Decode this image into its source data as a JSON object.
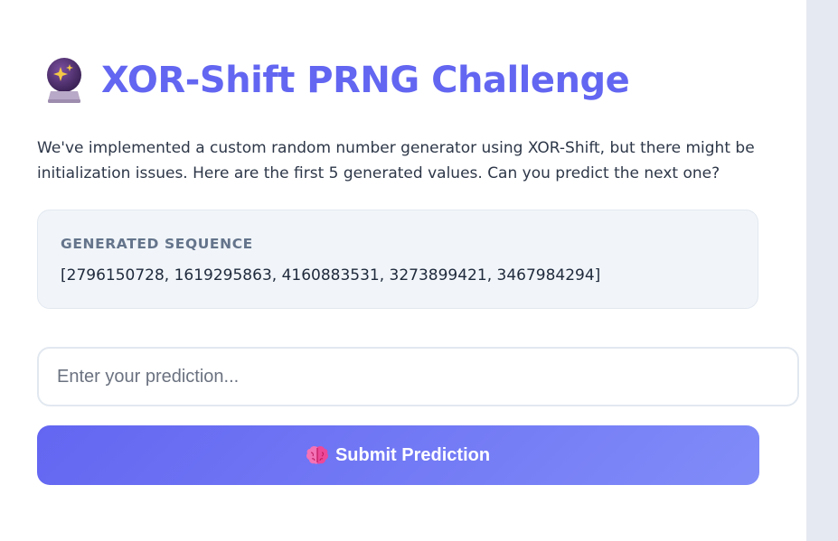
{
  "header": {
    "icon": "crystal-ball-icon",
    "title": "XOR-Shift PRNG Challenge"
  },
  "description": "We've implemented a custom random number generator using XOR-Shift, but there might be initialization issues. Here are the first 5 generated values. Can you predict the next one?",
  "sequence": {
    "label": "GENERATED SEQUENCE",
    "values_text": "[2796150728, 1619295863, 4160883531, 3273899421, 3467984294]"
  },
  "prediction": {
    "value": "",
    "placeholder": "Enter your prediction..."
  },
  "submit": {
    "icon": "brain-icon",
    "label": "Submit Prediction"
  },
  "colors": {
    "accent": "#6366f1",
    "accent_light": "#818cf8",
    "page_background": "#e5e9f2",
    "card_background": "#ffffff",
    "sequence_box_background": "#f1f5f9"
  }
}
